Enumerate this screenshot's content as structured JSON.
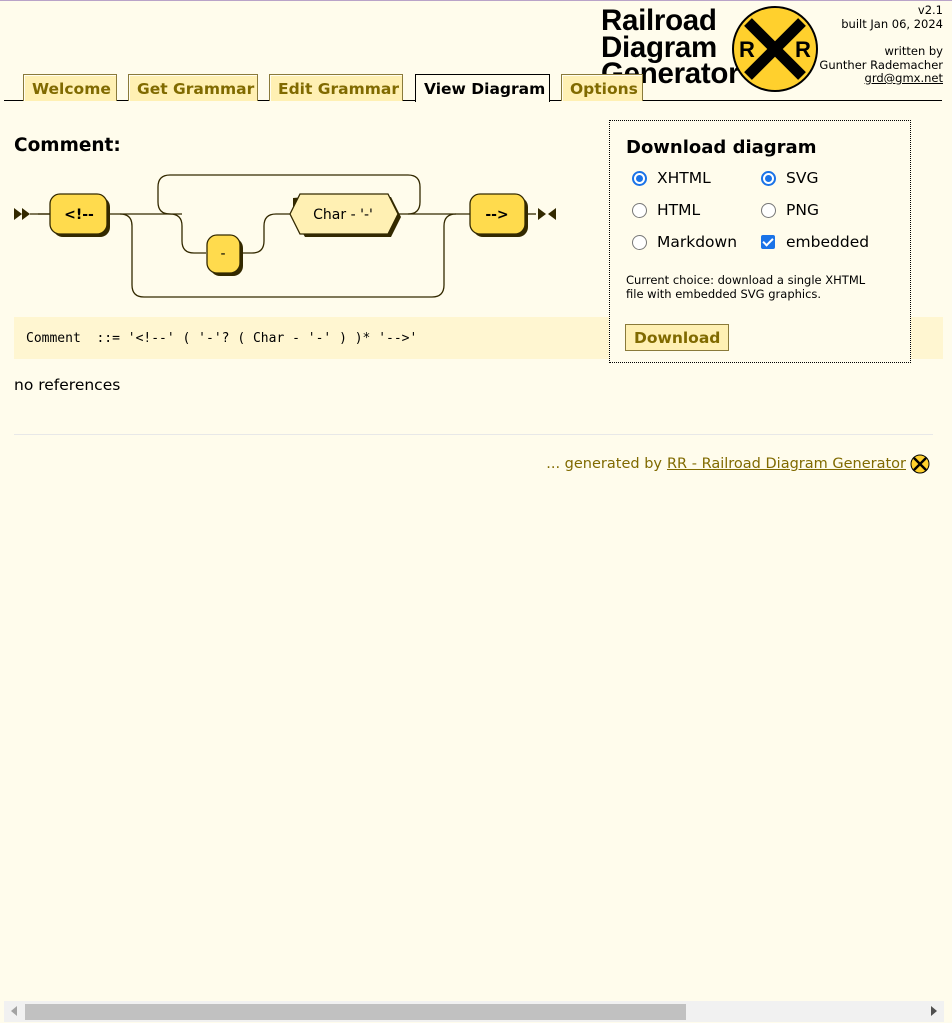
{
  "version": {
    "number": "v2.1",
    "built": "built Jan 06, 2024",
    "written_by": "written by",
    "author": "Gunther Rademacher",
    "email": "grd@gmx.net"
  },
  "logo": {
    "line1": "Railroad",
    "line2": "Diagram",
    "line3": "Generator",
    "badge_left": "R",
    "badge_right": "R",
    "colors": {
      "badge_fill": "#ffd02d",
      "badge_x": "#000000"
    }
  },
  "tabs": [
    {
      "label": "Welcome",
      "active": false
    },
    {
      "label": "Get Grammar",
      "active": false
    },
    {
      "label": "Edit Grammar",
      "active": false
    },
    {
      "label": "View Diagram",
      "active": true
    },
    {
      "label": "Options",
      "active": false
    }
  ],
  "production": {
    "title": "Comment:",
    "terminal_open": "<!--",
    "terminal_dash": "-",
    "nonterminal_char": "Char - '-'",
    "terminal_close": "-->",
    "ebnf": "Comment  ::= '<!--' ( '-'? ( Char - '-' ) )* '-->'",
    "references": "no references"
  },
  "download": {
    "title": "Download diagram",
    "options": {
      "xhtml": {
        "label": "XHTML",
        "checked": true
      },
      "html": {
        "label": "HTML",
        "checked": false
      },
      "markdown": {
        "label": "Markdown",
        "checked": false
      },
      "svg": {
        "label": "SVG",
        "checked": true
      },
      "png": {
        "label": "PNG",
        "checked": false
      },
      "embedded": {
        "label": "embedded",
        "checked": true
      }
    },
    "description": "Current choice: download a single XHTML file with embedded SVG graphics.",
    "button_label": "Download"
  },
  "footer": {
    "prefix": "... generated by",
    "link_text": "RR - Railroad Diagram Generator"
  },
  "colors": {
    "page_bg": "#fffcec",
    "tab_bg": "#fff0b3",
    "accent_text": "#806a00",
    "terminal_fill": "#ffdb4d",
    "nonterminal_fill": "#fff0b3",
    "ebnf_bg": "#fff6d1"
  }
}
